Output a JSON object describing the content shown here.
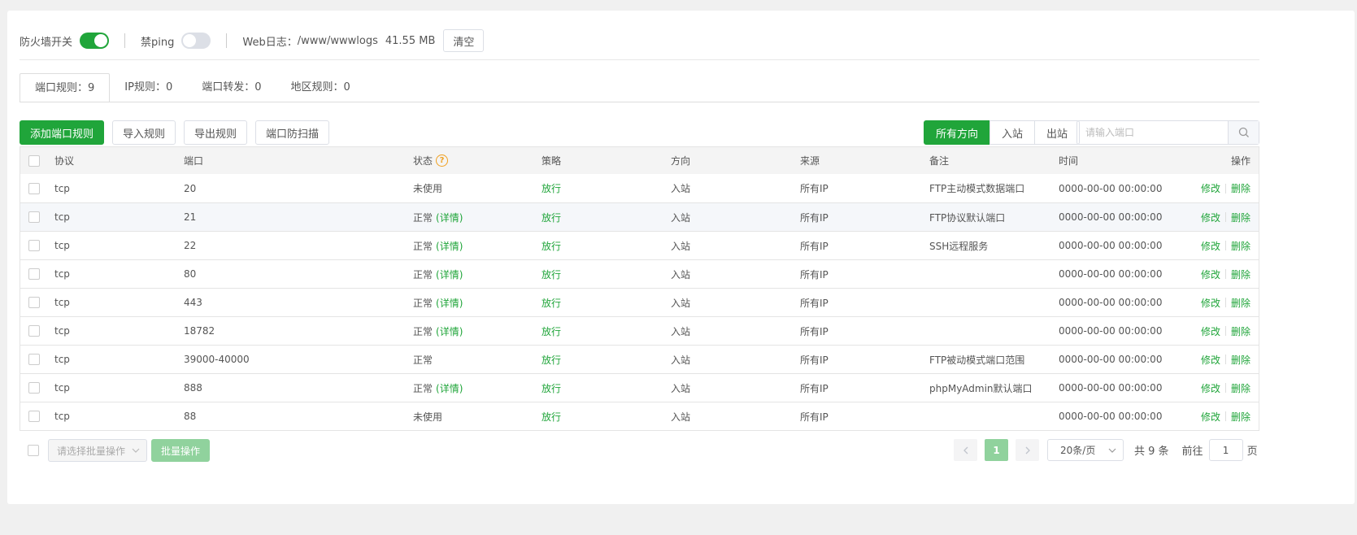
{
  "topbar": {
    "firewall_label": "防火墙开关",
    "ping_label": "禁ping",
    "weblog_label": "Web日志：",
    "weblog_path": "/www/wwwlogs",
    "weblog_size": "41.55 MB",
    "clear_label": "清空"
  },
  "tabs": [
    {
      "label": "端口规则：9"
    },
    {
      "label": "IP规则：0"
    },
    {
      "label": "端口转发：0"
    },
    {
      "label": "地区规则：0"
    }
  ],
  "toolbar": {
    "add_label": "添加端口规则",
    "import_label": "导入规则",
    "export_label": "导出规则",
    "scan_label": "端口防扫描"
  },
  "direction": {
    "all": "所有方向",
    "in": "入站",
    "out": "出站"
  },
  "search": {
    "placeholder": "请输入端口"
  },
  "table": {
    "headers": {
      "protocol": "协议",
      "port": "端口",
      "status": "状态",
      "strategy": "策略",
      "direction": "方向",
      "source": "来源",
      "remark": "备注",
      "time": "时间",
      "ops": "操作"
    },
    "detail_label": "(详情)",
    "edit_label": "修改",
    "delete_label": "删除",
    "rows": [
      {
        "protocol": "tcp",
        "port": "20",
        "status": "未使用",
        "strategy": "放行",
        "direction": "入站",
        "source": "所有IP",
        "remark": "FTP主动模式数据端口",
        "time": "0000-00-00 00:00:00"
      },
      {
        "protocol": "tcp",
        "port": "21",
        "status": "正常",
        "strategy": "放行",
        "direction": "入站",
        "source": "所有IP",
        "remark": "FTP协议默认端口",
        "time": "0000-00-00 00:00:00"
      },
      {
        "protocol": "tcp",
        "port": "22",
        "status": "正常",
        "strategy": "放行",
        "direction": "入站",
        "source": "所有IP",
        "remark": "SSH远程服务",
        "time": "0000-00-00 00:00:00"
      },
      {
        "protocol": "tcp",
        "port": "80",
        "status": "正常",
        "strategy": "放行",
        "direction": "入站",
        "source": "所有IP",
        "remark": "",
        "time": "0000-00-00 00:00:00"
      },
      {
        "protocol": "tcp",
        "port": "443",
        "status": "正常",
        "strategy": "放行",
        "direction": "入站",
        "source": "所有IP",
        "remark": "",
        "time": "0000-00-00 00:00:00"
      },
      {
        "protocol": "tcp",
        "port": "18782",
        "status": "正常",
        "strategy": "放行",
        "direction": "入站",
        "source": "所有IP",
        "remark": "",
        "time": "0000-00-00 00:00:00"
      },
      {
        "protocol": "tcp",
        "port": "39000-40000",
        "status": "正常",
        "strategy": "放行",
        "direction": "入站",
        "source": "所有IP",
        "remark": "FTP被动模式端口范围",
        "time": "0000-00-00 00:00:00"
      },
      {
        "protocol": "tcp",
        "port": "888",
        "status": "正常",
        "strategy": "放行",
        "direction": "入站",
        "source": "所有IP",
        "remark": "phpMyAdmin默认端口",
        "time": "0000-00-00 00:00:00"
      },
      {
        "protocol": "tcp",
        "port": "88",
        "status": "未使用",
        "strategy": "放行",
        "direction": "入站",
        "source": "所有IP",
        "remark": "",
        "time": "0000-00-00 00:00:00"
      }
    ]
  },
  "footer": {
    "batch_placeholder": "请选择批量操作",
    "batch_button": "批量操作",
    "current_page": "1",
    "page_size": "20条/页",
    "total": "共 9 条",
    "goto_prefix": "前往",
    "goto_value": "1",
    "goto_suffix": "页"
  },
  "colors": {
    "accent": "#20a53a",
    "warning": "#f0a020"
  }
}
